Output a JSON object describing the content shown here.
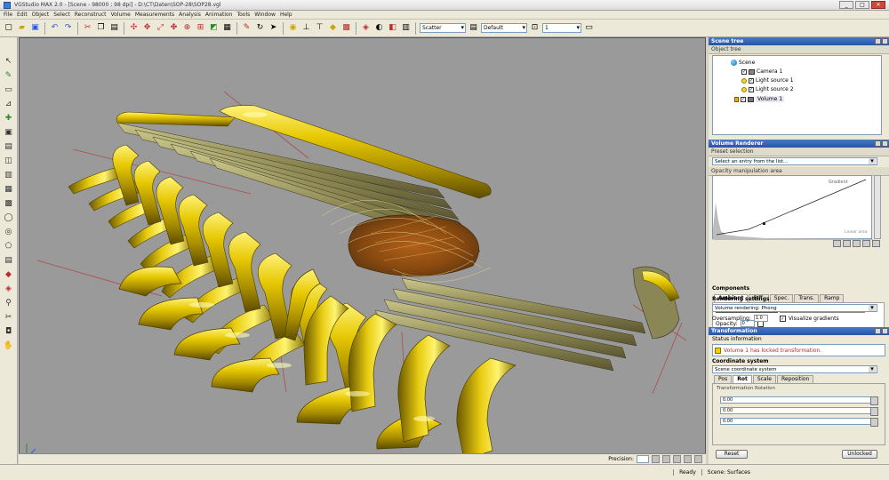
{
  "window": {
    "title": "VGStudio MAX 2.0 - [Scene - 98000 ; 98 dpi] - D:\\CT\\Daten\\SOP-28\\SOP28.vgl",
    "min": "_",
    "max": "□",
    "close": "✕"
  },
  "menu": [
    "File",
    "Edit",
    "Object",
    "Select",
    "Reconstruct",
    "Volume",
    "Measurements",
    "Analysis",
    "Animation",
    "Tools",
    "Window",
    "Help"
  ],
  "toolbar": {
    "render_mode": "Scatter",
    "view": "Default",
    "zoom": "1"
  },
  "scene_panel": {
    "title": "Scene tree",
    "subtitle": "Object tree",
    "items": {
      "root": "Scene",
      "camera": "Camera 1",
      "light1": "Light source 1",
      "light2": "Light source 2",
      "volume": "Volume 1"
    }
  },
  "volume_panel": {
    "title": "Volume Renderer",
    "preset_label": "Preset selection",
    "preset_value": "Select an entry from the list...",
    "manip_label": "Opacity manipulation area",
    "curve_label": "Gradient",
    "curve_value": "Linear area",
    "components_label": "Components",
    "tabs": [
      "Ambient",
      "Diff.",
      "Spec.",
      "Trans.",
      "Ramp"
    ],
    "opacity_label": "Opacity:",
    "opacity_value": "0",
    "render_label": "Rendering settings",
    "render_value": "Volume rendering: Phong",
    "oversampling_label": "Oversampling:",
    "oversampling_value": "1.0",
    "interp_label": "Visualize gradients"
  },
  "xform_panel": {
    "title": "Transformation",
    "status_label": "Status information",
    "status_msg": "Volume 1 has locked transformation.",
    "coord_label": "Coordinate system",
    "coord_value": "Scene coordinate system",
    "tabs": [
      "Pos",
      "Rot",
      "Scale",
      "Reposition"
    ],
    "group_label": "Transformation Rotation",
    "x": "0.00",
    "y": "0.00",
    "z": "0.00",
    "reset": "Reset",
    "apply": "Unlocked"
  },
  "viewport": {
    "precision_label": "Precision:"
  },
  "status": {
    "state": "Ready",
    "scene": "Scene: Surfaces"
  }
}
